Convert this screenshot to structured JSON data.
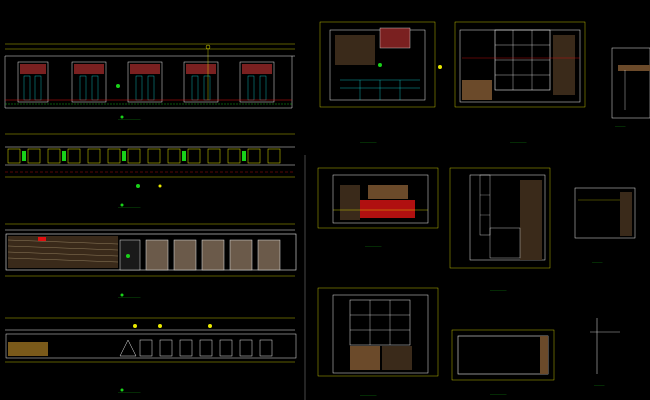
{
  "canvas": {
    "background": "#000000",
    "colors": {
      "white": "#e8e8e8",
      "yellow": "#e8e800",
      "green": "#19d219",
      "red": "#e01010",
      "cyan": "#10d8d8",
      "grey": "#7a7a7a",
      "brown": "#6b4a2a",
      "tan": "#c8b48a"
    }
  },
  "drawing_blocks": [
    {
      "id": "elevation-1"
    },
    {
      "id": "elevation-2"
    },
    {
      "id": "elevation-3"
    },
    {
      "id": "elevation-4"
    },
    {
      "id": "section-a"
    },
    {
      "id": "section-b"
    },
    {
      "id": "section-c"
    },
    {
      "id": "section-d"
    },
    {
      "id": "section-e"
    },
    {
      "id": "section-f"
    },
    {
      "id": "section-g"
    },
    {
      "id": "section-h"
    },
    {
      "id": "section-i"
    },
    {
      "id": "section-j"
    }
  ]
}
